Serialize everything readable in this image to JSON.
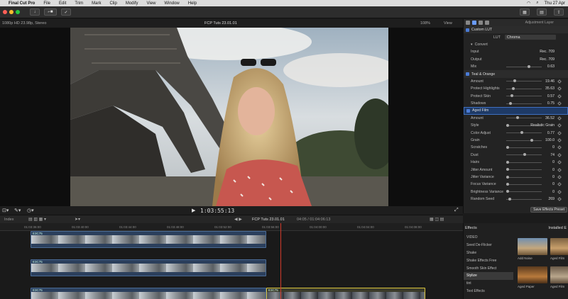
{
  "menubar": {
    "app": "Final Cut Pro",
    "items": [
      "File",
      "Edit",
      "Trim",
      "Mark",
      "Clip",
      "Modify",
      "View",
      "Window",
      "Help"
    ],
    "clock": "Thu 27 Apr"
  },
  "viewer": {
    "format": "1080p HD 23.98p, Stereo",
    "project": "FCP Tuts 23.01.01",
    "zoom": "108%",
    "view": "View",
    "timecode": "1:03:55:13"
  },
  "inspector": {
    "layer_name": "Adjustment Layer",
    "custom_lut": {
      "title": "Custom LUT",
      "lut_label": "LUT",
      "lut_value": "Chroma",
      "convert_label": "Convert",
      "input_label": "Input",
      "input_value": "Rec. 709",
      "output_label": "Output",
      "output_value": "Rec. 709",
      "mix_label": "Mix",
      "mix_value": "0.63"
    },
    "teal_orange": {
      "title": "Teal & Orange",
      "rows": [
        {
          "label": "Amount",
          "value": "19.46"
        },
        {
          "label": "Protect Highlights",
          "value": "35.63"
        },
        {
          "label": "Protect Skin",
          "value": "0.57"
        },
        {
          "label": "Shadows",
          "value": "0.75"
        }
      ]
    },
    "aged_film": {
      "title": "Aged Film",
      "rows": [
        {
          "label": "Amount",
          "value": "36.52"
        },
        {
          "label": "Style",
          "value": "Realistic Grain"
        },
        {
          "label": "Color Adjust",
          "value": "0.77"
        },
        {
          "label": "Grain",
          "value": "100.0"
        },
        {
          "label": "Scratches",
          "value": "0"
        },
        {
          "label": "Dust",
          "value": "74"
        },
        {
          "label": "Hairs",
          "value": "0"
        },
        {
          "label": "Jitter Amount",
          "value": "0"
        },
        {
          "label": "Jitter Variance",
          "value": "0"
        },
        {
          "label": "Focus Variance",
          "value": "0"
        },
        {
          "label": "Brightness Variance",
          "value": "0"
        },
        {
          "label": "Random Seed",
          "value": "269"
        }
      ]
    },
    "save_button": "Save Effects Preset"
  },
  "timeline": {
    "index": "Index",
    "project": "FCP Tuts 23.01.01",
    "duration": "04:05 / 01:04:06:13",
    "ruler_ticks": [
      "01:03:36:00",
      "01:03:40:00",
      "01:03:44:00",
      "01:03:48:00",
      "01:03:52:00",
      "01:03:56:00",
      "01:04:00:00",
      "01:04:04:00",
      "01:04:08:00"
    ],
    "clip_label": "E3C75"
  },
  "effects": {
    "title": "Effects",
    "installed": "Installed E",
    "items": [
      "VIDEO",
      "Seed De-Flicker",
      "Shake",
      "Shake Effects Free",
      "Smooth Skin Effect",
      "Stylize",
      "tint",
      "Text Effects"
    ],
    "selected_index": 5,
    "tiles": [
      "Add Noise",
      "Aged Film",
      "Aged Paper",
      "Aged Film"
    ]
  },
  "colors": {
    "accent": "#4a7bd6",
    "playhead": "#d03a2a",
    "clip": "#2b3f5c",
    "selected_clip": "#d8c33a"
  }
}
